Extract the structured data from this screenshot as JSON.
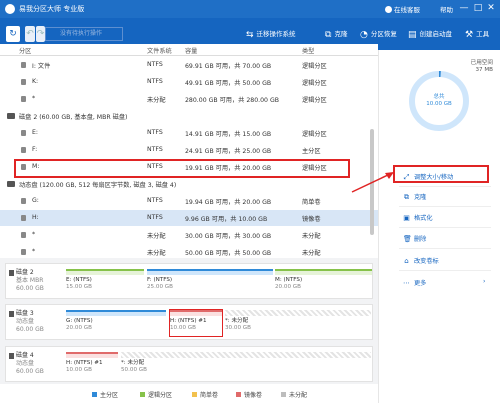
{
  "titlebar": {
    "title": "易我分区大师 专业版",
    "online_help": "在线客服",
    "help": "帮助",
    "min_glyph": "—",
    "max_glyph": "□",
    "close_glyph": "✕"
  },
  "toolbar": {
    "refresh_glyph": "↻",
    "undo_glyph": "↶",
    "redo_glyph": "↷",
    "pending_label": "没有待执行操作",
    "items": [
      {
        "label": "迁移操作系统",
        "icon": "migrate-icon",
        "glyph": "⇆"
      },
      {
        "label": "克隆",
        "icon": "clone-icon",
        "glyph": "⧉"
      },
      {
        "label": "分区恢复",
        "icon": "recover-icon",
        "glyph": "◔"
      },
      {
        "label": "创建启动盘",
        "icon": "bootdisk-icon",
        "glyph": "▤"
      },
      {
        "label": "工具",
        "icon": "tools-icon",
        "glyph": "⚒"
      }
    ]
  },
  "columns": {
    "partition": "分区",
    "fs": "文件系统",
    "capacity": "容量",
    "type": "类型"
  },
  "rows": [
    {
      "kind": "part",
      "name": "I: 文件",
      "fs": "NTFS",
      "cap": "69.91 GB  可用，共  70.00 GB",
      "type": "逻辑分区"
    },
    {
      "kind": "part",
      "name": "K:",
      "fs": "NTFS",
      "cap": "49.91 GB  可用，共  50.00 GB",
      "type": "逻辑分区"
    },
    {
      "kind": "part",
      "name": "*",
      "fs": "未分配",
      "cap": "280.00 GB 可用，共  280.00 GB",
      "type": "逻辑分区"
    },
    {
      "kind": "disk",
      "name": "磁盘 2 (60.00 GB, 基本盘, MBR 磁盘)"
    },
    {
      "kind": "part",
      "name": "E:",
      "fs": "NTFS",
      "cap": "14.91 GB  可用，共  15.00 GB",
      "type": "逻辑分区"
    },
    {
      "kind": "part",
      "name": "F:",
      "fs": "NTFS",
      "cap": "24.91 GB  可用，共  25.00 GB",
      "type": "主分区"
    },
    {
      "kind": "part",
      "name": "M:",
      "fs": "NTFS",
      "cap": "19.91 GB  可用，共  20.00 GB",
      "type": "逻辑分区"
    },
    {
      "kind": "disk",
      "name": "动态盘 (120.00 GB, 512 每扇区字节数, 磁盘 3, 磁盘 4)"
    },
    {
      "kind": "part",
      "name": "G:",
      "fs": "NTFS",
      "cap": "19.94 GB  可用，共  20.00 GB",
      "type": "简单卷"
    },
    {
      "kind": "part",
      "name": "H:",
      "fs": "NTFS",
      "cap": "9.96 GB  可用，共  10.00 GB",
      "type": "镜像卷",
      "selected": true
    },
    {
      "kind": "part",
      "name": "*",
      "fs": "未分配",
      "cap": "30.00 GB 可用，共  30.00 GB",
      "type": "未分配"
    },
    {
      "kind": "part",
      "name": "*",
      "fs": "未分配",
      "cap": "50.00 GB 可用，共  50.00 GB",
      "type": "未分配"
    }
  ],
  "diskmap": [
    {
      "name": "磁盘 2",
      "sub": "基本 MBR",
      "size": "60.00 GB",
      "parts": [
        {
          "label": "E: (NTFS)",
          "size": "15.00 GB",
          "kind": "logical"
        },
        {
          "label": "F: (NTFS)",
          "size": "25.00 GB",
          "kind": "primary"
        },
        {
          "label": "M: (NTFS)",
          "size": "20.00 GB",
          "kind": "logical"
        }
      ]
    },
    {
      "name": "磁盘 3",
      "sub": "动态盘",
      "size": "60.00 GB",
      "parts": [
        {
          "label": "G: (NTFS)",
          "size": "20.00 GB",
          "kind": "primary"
        },
        {
          "label": "H: (NTFS) #1",
          "size": "10.00 GB",
          "kind": "mirror",
          "selected": true
        },
        {
          "label": "*: 未分配",
          "size": "30.00 GB",
          "kind": "free"
        }
      ]
    },
    {
      "name": "磁盘 4",
      "sub": "动态盘",
      "size": "60.00 GB",
      "parts": [
        {
          "label": "H: (NTFS) #1",
          "size": "10.00 GB",
          "kind": "mirror"
        },
        {
          "label": "*: 未分配",
          "size": "50.00 GB",
          "kind": "free"
        }
      ]
    }
  ],
  "legend": [
    {
      "label": "主分区",
      "color": "#2f8ad8"
    },
    {
      "label": "逻辑分区",
      "color": "#86c24a"
    },
    {
      "label": "简单卷",
      "color": "#f2c14e"
    },
    {
      "label": "镜像卷",
      "color": "#e06a6a"
    },
    {
      "label": "未分配",
      "color": "#bdbdbd"
    }
  ],
  "panel": {
    "used_label": "已用空间",
    "used_value": "37 MB",
    "donut_name": "总共",
    "donut_total": "10.00 GB",
    "used_fraction": 0.0037,
    "actions": [
      {
        "label": "调整大小/移动",
        "icon": "resize-icon",
        "glyph": "⤢"
      },
      {
        "label": "克隆",
        "icon": "clone-icon",
        "glyph": "⧉"
      },
      {
        "label": "格式化",
        "icon": "format-icon",
        "glyph": "▣"
      },
      {
        "label": "删除",
        "icon": "delete-icon",
        "glyph": "🗑"
      },
      {
        "label": "改变卷标",
        "icon": "label-icon",
        "glyph": "⌂"
      },
      {
        "label": "更多",
        "icon": "more-icon",
        "glyph": "⋯"
      }
    ],
    "more_chevron": "›"
  },
  "colors": {
    "titlebar": "#1f6fc6",
    "toolbar": "#1565c0",
    "highlight": "#e02424",
    "selected_row": "#d8e6f6"
  }
}
